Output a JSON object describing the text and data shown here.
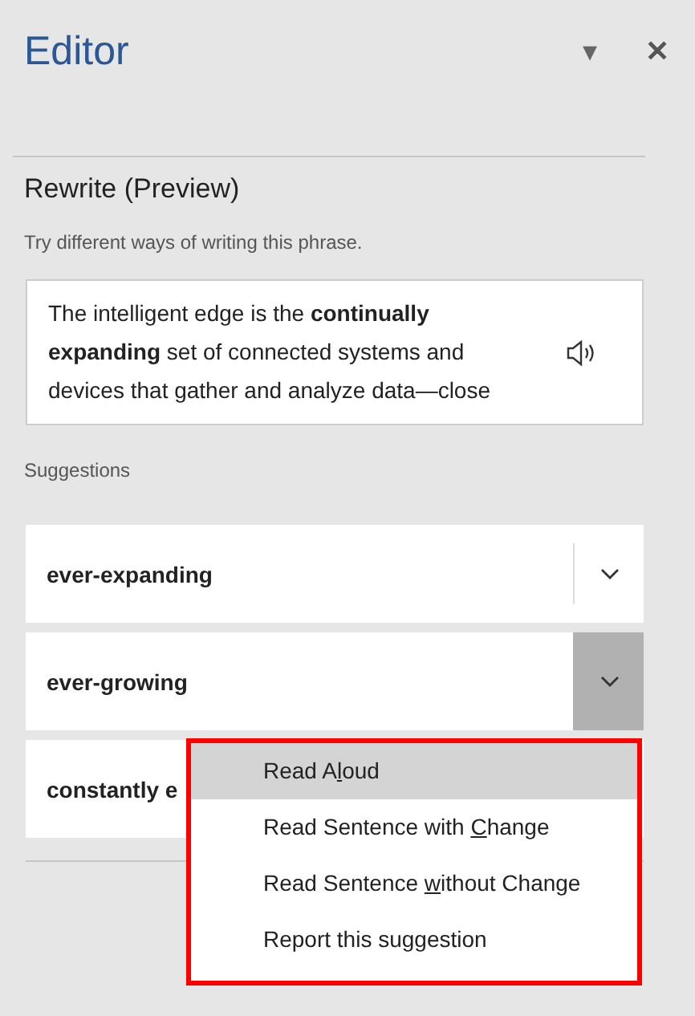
{
  "pane": {
    "title": "Editor",
    "options_glyph": "▾",
    "close_glyph": "✕"
  },
  "rewrite": {
    "heading": "Rewrite (Preview)",
    "hint": "Try different ways of writing this phrase.",
    "lines": [
      "The intelligent edge is the **continually**",
      "**expanding** set of connected systems and",
      "devices that gather and analyze data—close"
    ]
  },
  "suggestions": {
    "heading": "Suggestions",
    "items": [
      {
        "text": "ever-expanding",
        "expanded": false
      },
      {
        "text": "ever-growing",
        "expanded": true
      },
      {
        "text": "constantly e"
      }
    ]
  },
  "menu": {
    "items": [
      {
        "before": "Read A",
        "key": "l",
        "after": "oud",
        "selected": true
      },
      {
        "before": "Read Sentence with ",
        "key": "C",
        "after": "hange",
        "selected": false
      },
      {
        "before": "Read Sentence ",
        "key": "w",
        "after": "ithout Change",
        "selected": false
      },
      {
        "before": "Report this suggestion",
        "selected": false
      }
    ]
  }
}
